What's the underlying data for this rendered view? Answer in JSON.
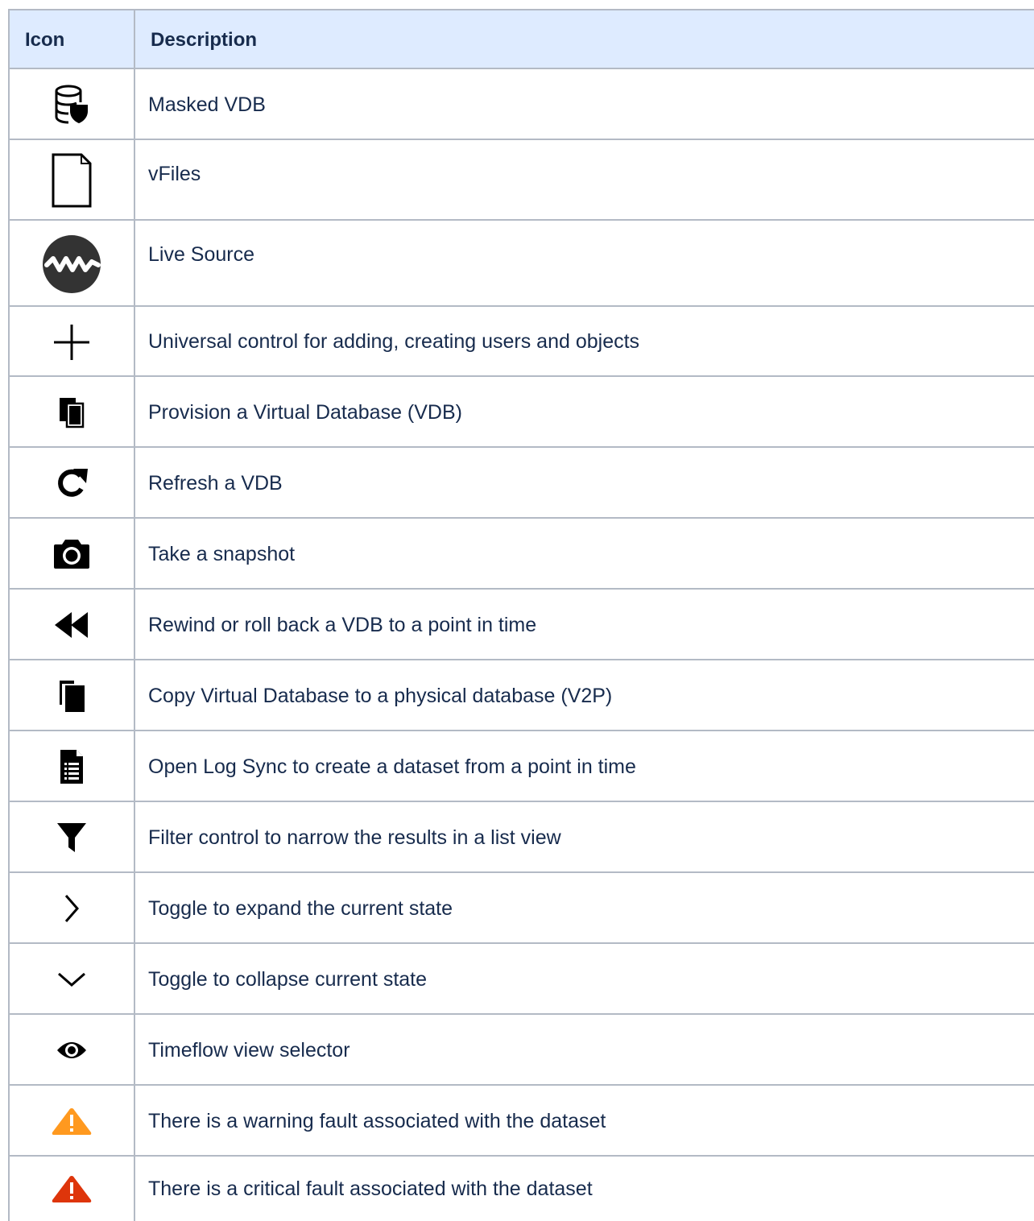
{
  "table": {
    "headers": {
      "icon": "Icon",
      "description": "Description"
    },
    "rows": [
      {
        "icon": "masked-vdb-icon",
        "description": "Masked VDB"
      },
      {
        "icon": "vfiles-icon",
        "description": "vFiles"
      },
      {
        "icon": "live-source-icon",
        "description": "Live Source"
      },
      {
        "icon": "plus-icon",
        "description": "Universal control for adding, creating users and objects"
      },
      {
        "icon": "provision-vdb-icon",
        "description": "Provision a Virtual Database (VDB)"
      },
      {
        "icon": "refresh-icon",
        "description": "Refresh a VDB"
      },
      {
        "icon": "camera-icon",
        "description": "Take a snapshot"
      },
      {
        "icon": "rewind-icon",
        "description": "Rewind or roll back a VDB to a point in time"
      },
      {
        "icon": "copy-v2p-icon",
        "description": "Copy Virtual Database to a physical database (V2P)"
      },
      {
        "icon": "log-sync-icon",
        "description": "Open Log Sync to create a dataset from a point in time"
      },
      {
        "icon": "filter-icon",
        "description": "Filter control to narrow the results in a list view"
      },
      {
        "icon": "chevron-right-icon",
        "description": "Toggle to expand the current state"
      },
      {
        "icon": "chevron-down-icon",
        "description": "Toggle to collapse current state"
      },
      {
        "icon": "eye-icon",
        "description": "Timeflow view selector"
      },
      {
        "icon": "warning-icon",
        "description": "There is a warning fault associated with the dataset"
      },
      {
        "icon": "critical-icon",
        "description": "There is a critical fault associated with the dataset"
      }
    ]
  },
  "colors": {
    "header_bg": "#deebff",
    "border": "#b3bac5",
    "text": "#172b4d",
    "warning": "#ff991f",
    "critical": "#de350b"
  }
}
